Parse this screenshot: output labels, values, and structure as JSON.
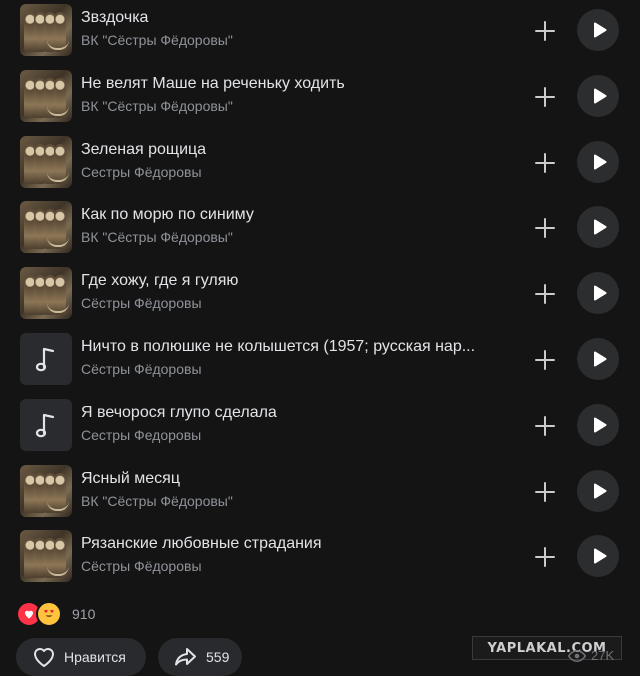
{
  "tracks": [
    {
      "title": "Звздочка",
      "artist": "ВК \"Сёстры Фёдоровы\"",
      "cover": "photo"
    },
    {
      "title": "Не велят Маше на реченьку ходить",
      "artist": "ВК \"Сёстры Фёдоровы\"",
      "cover": "photo"
    },
    {
      "title": "Зеленая рощица",
      "artist": "Сестры Фёдоровы",
      "cover": "photo"
    },
    {
      "title": "Как по морю по синиму",
      "artist": "ВК \"Сёстры Фёдоровы\"",
      "cover": "photo"
    },
    {
      "title": "Где хожу, где я гуляю",
      "artist": "Сёстры Фёдоровы",
      "cover": "photo"
    },
    {
      "title": "Ничто в полюшке не колышется (1957; русская нар...",
      "artist": "Сёстры Фёдоровы",
      "cover": "note"
    },
    {
      "title": "Я вечорося глупо сделала",
      "artist": "Сестры Федоровы",
      "cover": "note"
    },
    {
      "title": "Ясный месяц",
      "artist": "ВК \"Сёстры Фёдоровы\"",
      "cover": "photo"
    },
    {
      "title": "Рязанские любовные страдания",
      "artist": "Сёстры Фёдоровы",
      "cover": "photo"
    }
  ],
  "icons": {
    "add": "plus-icon",
    "play": "play-icon",
    "note": "music-note-icon",
    "heart": "heart-icon",
    "share": "share-arrow-icon",
    "eye": "eye-icon"
  },
  "reactions": {
    "count": "910",
    "emojis": [
      "heart-reaction",
      "heart-eyes-reaction"
    ]
  },
  "like": {
    "label": "Нравится"
  },
  "share": {
    "count": "559"
  },
  "views": {
    "count": "27K"
  },
  "watermark": "YAPLAKAL.COM",
  "colors": {
    "background": "#141414",
    "primary_text": "#e1e3e6",
    "secondary_text": "#8f9399",
    "button_bg": "#2c2d2f"
  }
}
